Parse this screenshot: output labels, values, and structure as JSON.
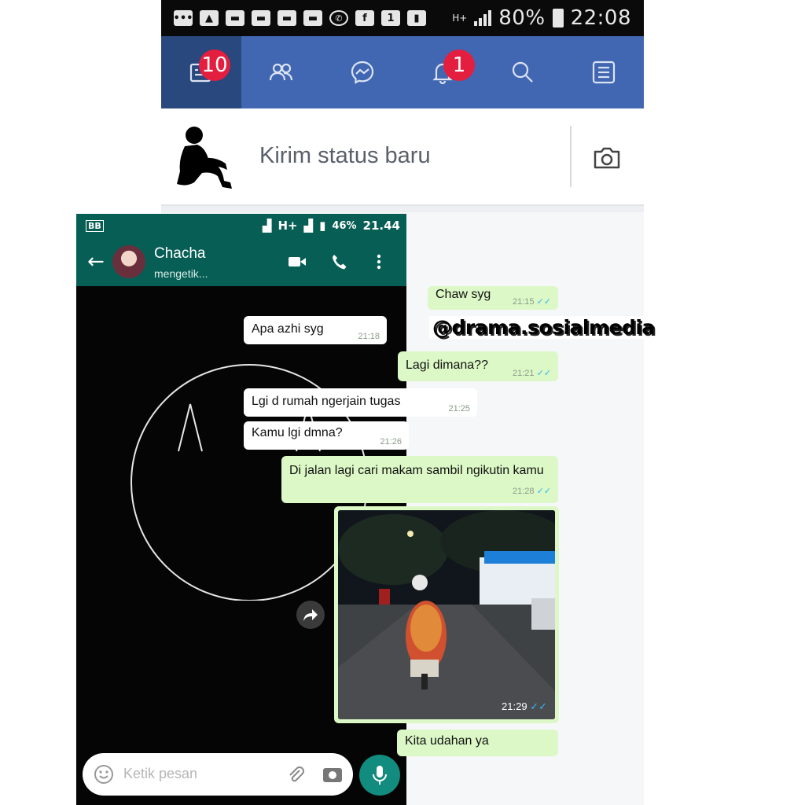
{
  "status_bar": {
    "battery": "80%",
    "time": "22:08",
    "sim_badge": "1"
  },
  "fb_nav": {
    "tabs": [
      {
        "name": "news-feed",
        "badge": "10",
        "active": true
      },
      {
        "name": "friends",
        "badge": null
      },
      {
        "name": "messenger",
        "badge": null
      },
      {
        "name": "notifications",
        "badge": "1"
      },
      {
        "name": "search",
        "badge": null
      },
      {
        "name": "menu",
        "badge": null
      }
    ],
    "colors": {
      "bar": "#4267b2",
      "active": "#29487d",
      "badge": "#e41e3f"
    }
  },
  "composer": {
    "placeholder": "Kirim status baru",
    "camera_icon": "camera-icon"
  },
  "whatsapp": {
    "status": {
      "battery": "46%",
      "time": "21.44",
      "network": "H+"
    },
    "contact_name": "Chacha",
    "contact_status": "mengetik...",
    "messages": [
      {
        "dir": "out",
        "text": "Chaw syg",
        "time": "21:15"
      },
      {
        "dir": "in",
        "text": "Apa azhi syg",
        "time": "21:18"
      },
      {
        "dir": "out",
        "text": "Lagi dimana??",
        "time": "21:21"
      },
      {
        "dir": "in",
        "text": "Lgi d rumah ngerjain tugas",
        "time": "21:25"
      },
      {
        "dir": "in",
        "text": "Kamu lgi dmna?",
        "time": "21:26"
      },
      {
        "dir": "out",
        "text": "Di jalan lagi cari makam sambil ngikutin kamu",
        "time": "21:28"
      },
      {
        "dir": "out",
        "type": "image",
        "time": "21:29"
      },
      {
        "dir": "out",
        "text": "Kita udahan ya",
        "time": ""
      }
    ],
    "input_placeholder": "Ketik pesan",
    "colors": {
      "header": "#075e54",
      "out_bubble": "#dcf8c6",
      "in_bubble": "#ffffff",
      "mic": "#128c7e"
    }
  },
  "watermark": "@drama.sosialmedia"
}
